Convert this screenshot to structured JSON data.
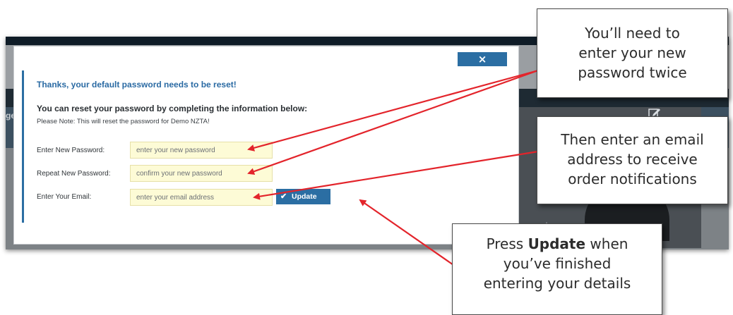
{
  "modal": {
    "close_symbol": "×",
    "title": "Thanks, your default password needs to be reset!",
    "heading": "You can reset your password by completing the information below:",
    "note": "Please Note: This will reset the password for Demo NZTA!",
    "fields": [
      {
        "label": "Enter New Password:",
        "placeholder": "enter your new password"
      },
      {
        "label": "Repeat New Password:",
        "placeholder": "confirm your new password"
      },
      {
        "label": "Enter Your Email:",
        "placeholder": "enter your email address"
      }
    ],
    "update_label": "Update",
    "update_icon": "check-icon"
  },
  "background_app": {
    "fragments": [
      "ge",
      "pla"
    ]
  },
  "callouts": {
    "c1": [
      "You’ll need to",
      "enter your new",
      "password twice"
    ],
    "c2": [
      "Then enter an email",
      "address to receive",
      "order notifications"
    ],
    "c3": {
      "press": "Press ",
      "update": "Update",
      "rest1": " when",
      "line2": "you’ve finished",
      "line3": "entering your details"
    }
  },
  "colors": {
    "accent_blue": "#2b6ea3",
    "input_yellow": "#fdfbd6",
    "arrow_red": "#e3242b",
    "title_blue": "#2a6aa3"
  }
}
